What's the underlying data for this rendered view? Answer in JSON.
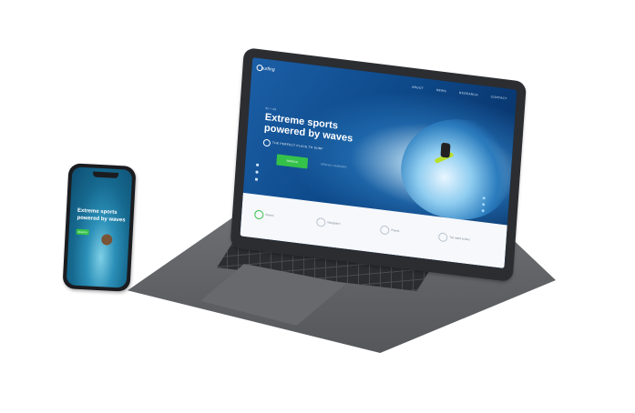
{
  "laptop_site": {
    "logo": "surfing",
    "nav": [
      "ABOUT",
      "NEWS",
      "RESEARCH",
      "CONTACT"
    ],
    "slide_counter": "01 — 03",
    "hero_title": "Extreme sports powered by waves",
    "hero_subtitle": "THE PERFECT PLACE TO SURF",
    "cta_label": "SEARCH",
    "cta_secondary": "VIEW ALL SURFERS",
    "features": [
      {
        "label": "Waves",
        "icon": "wave-icon"
      },
      {
        "label": "Navigation",
        "icon": "compass-icon"
      },
      {
        "label": "Places",
        "icon": "pin-icon"
      },
      {
        "label": "Top rated surfers",
        "icon": "star-icon"
      }
    ],
    "accent": "#35c24a",
    "brand_blue": "#0e4b8c"
  },
  "phone_site": {
    "hero_title": "Extreme sports powered by waves",
    "cta_label": "SEARCH"
  }
}
